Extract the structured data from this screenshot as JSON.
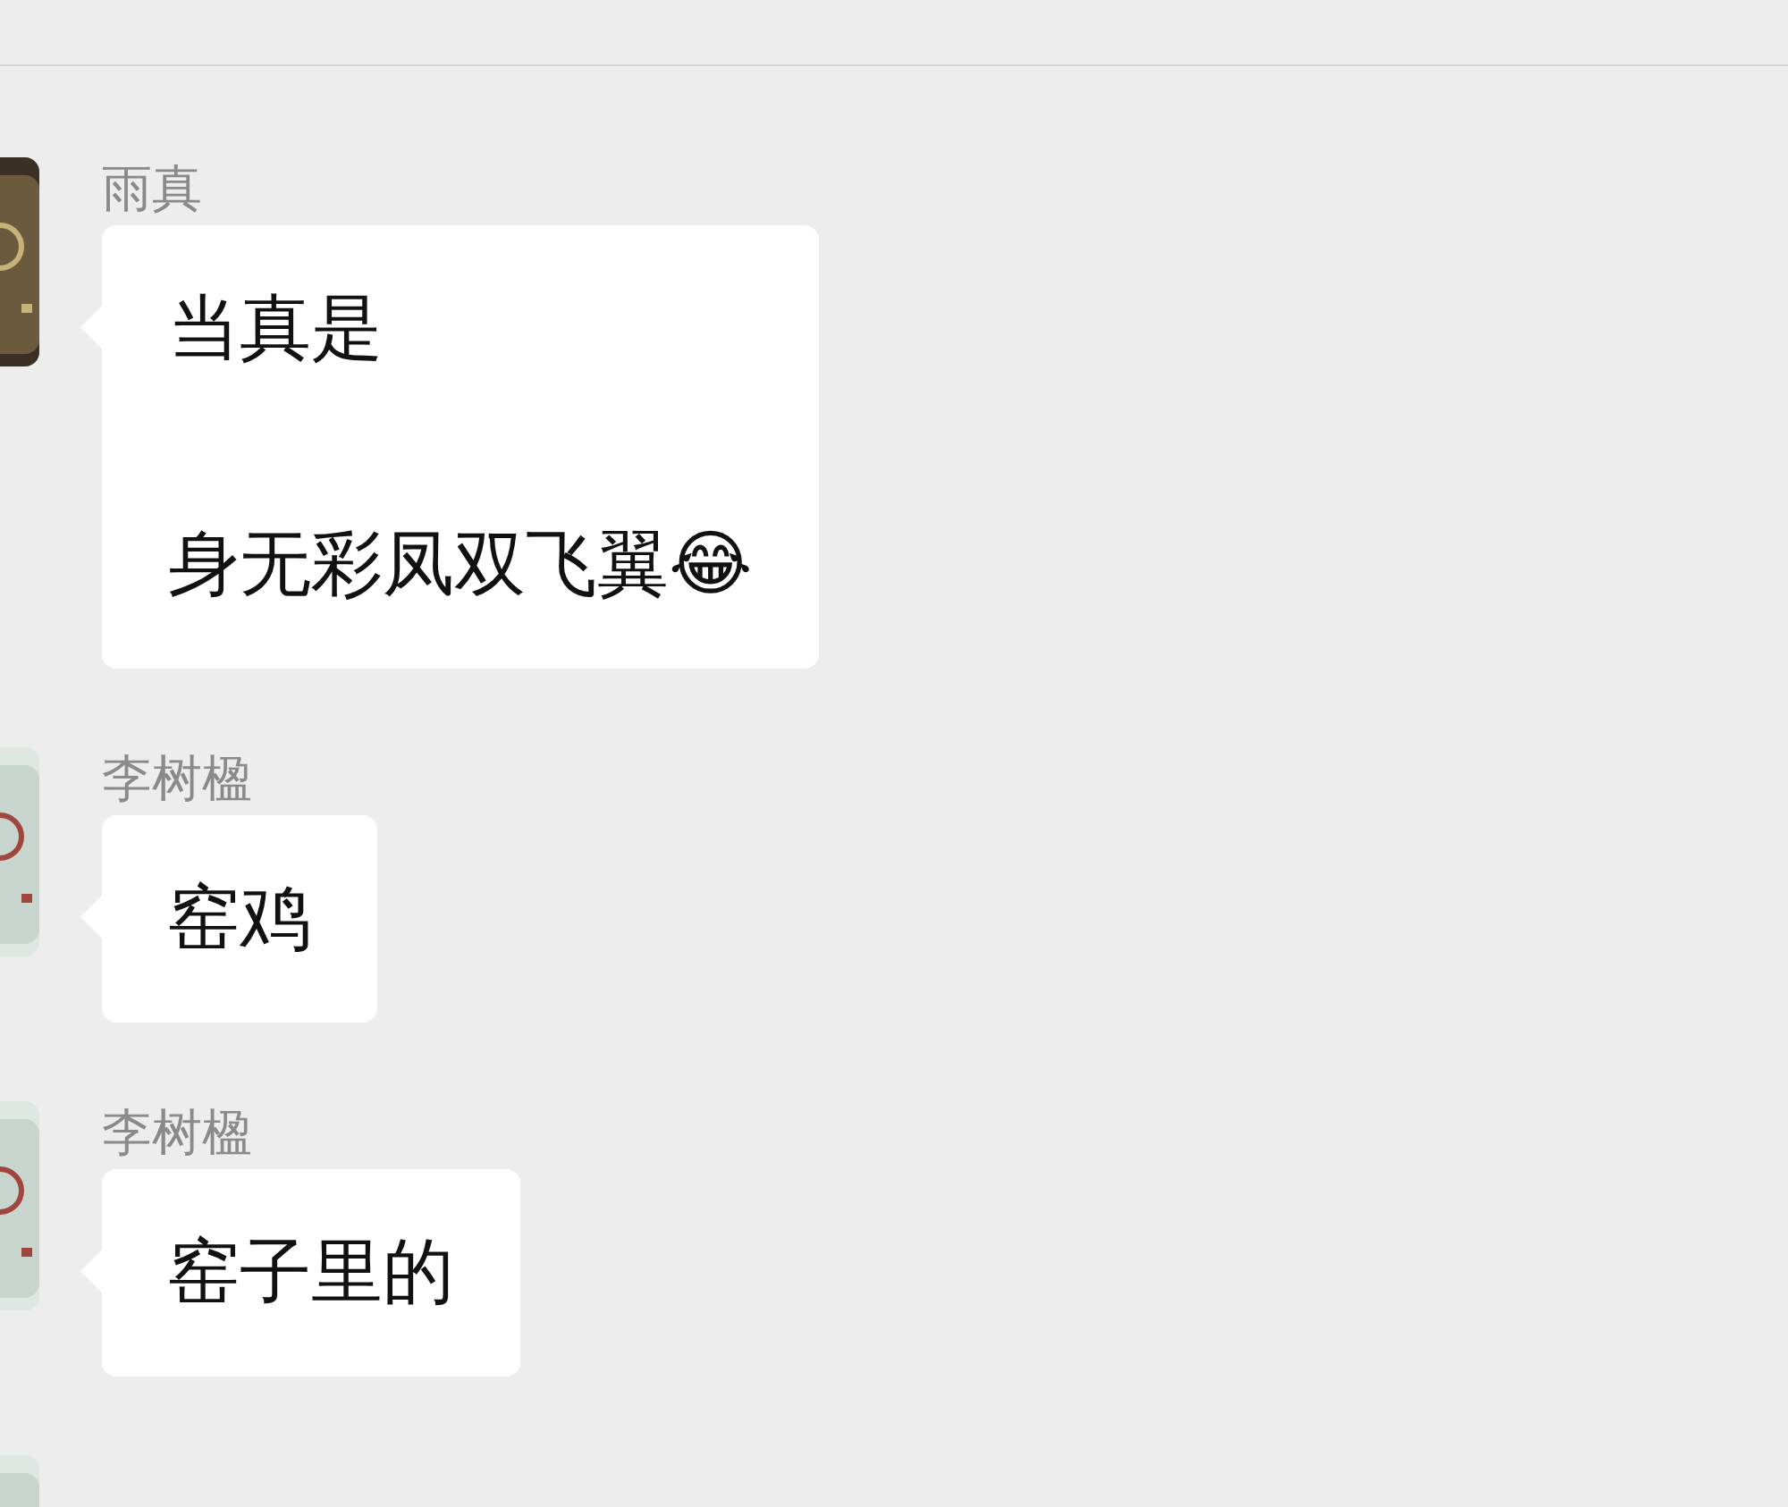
{
  "messages": [
    {
      "sender": "雨真",
      "lines": [
        "当真是",
        "身无彩凤双飞翼😂"
      ]
    },
    {
      "sender": "李树楹",
      "lines": [
        "窑鸡"
      ]
    },
    {
      "sender": "李树楹",
      "lines": [
        "窑子里的"
      ]
    }
  ]
}
